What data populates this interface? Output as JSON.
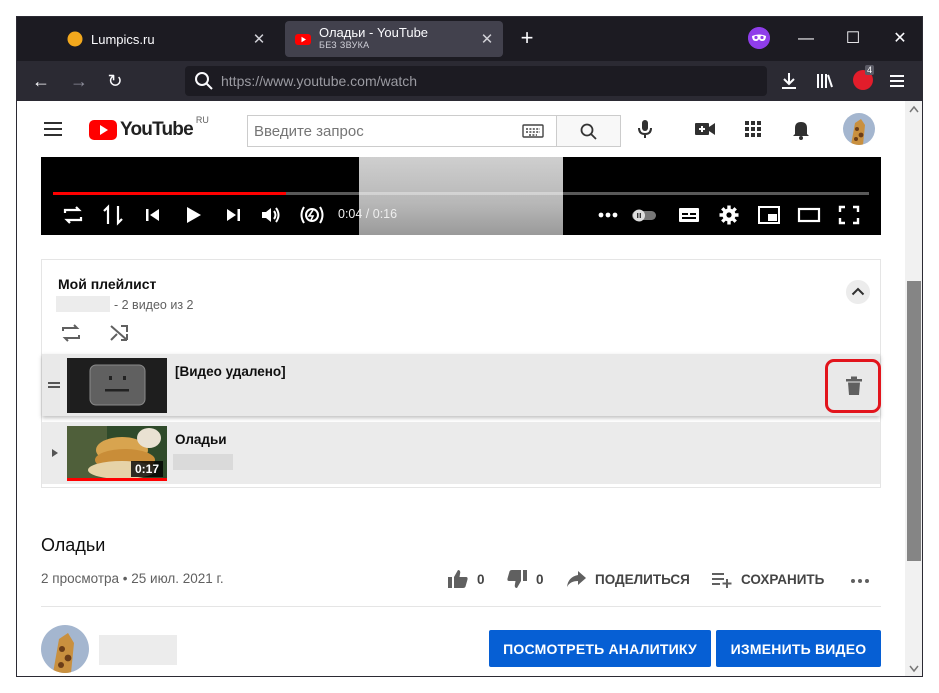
{
  "browser": {
    "tabs": [
      {
        "title": "Lumpics.ru",
        "subtitle": ""
      },
      {
        "title": "Оладьи - YouTube",
        "subtitle": "БЕЗ ЗВУКА"
      }
    ],
    "url": "https://www.youtube.com/watch",
    "extension_badge": "4",
    "accent": "#2b2a33"
  },
  "youtube": {
    "logo_text": "YouTube",
    "logo_region": "RU",
    "search_placeholder": "Введите запрос"
  },
  "player": {
    "time": "0:04 / 0:16",
    "progress_fraction": 0.285
  },
  "playlist": {
    "title": "Мой плейлист",
    "count": "- 2 видео из 2",
    "items": [
      {
        "title": "[Видео удалено]",
        "duration": ""
      },
      {
        "title": "Оладьи",
        "duration": "0:17"
      }
    ]
  },
  "video": {
    "title": "Оладьи",
    "meta": "2 просмотра • 25 июл. 2021 г.",
    "likes": "0",
    "dislikes": "0",
    "share_label": "ПОДЕЛИТЬСЯ",
    "save_label": "СОХРАНИТЬ"
  },
  "channel": {
    "analytics_label": "ПОСМОТРЕТЬ АНАЛИТИКУ",
    "edit_label": "ИЗМЕНИТЬ ВИДЕО"
  },
  "colors": {
    "brand": "#ff0000",
    "button": "#065fd4",
    "highlight": "#e2141c"
  }
}
